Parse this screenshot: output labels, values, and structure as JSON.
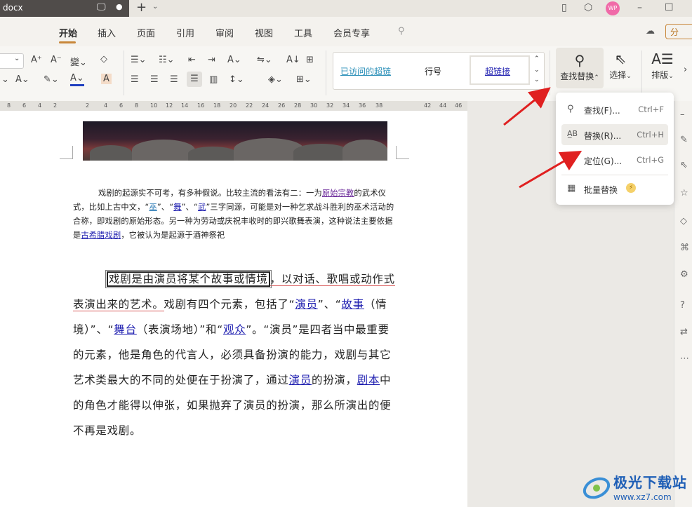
{
  "titlebar": {
    "doc_name": "docx",
    "modified_dot": "●",
    "new_tab": "+",
    "avatar": "WP"
  },
  "menu": {
    "items": [
      "开始",
      "插入",
      "页面",
      "引用",
      "审阅",
      "视图",
      "工具",
      "会员专享"
    ],
    "share": "分"
  },
  "ribbon": {
    "styles": [
      "已访问的超链",
      "行号",
      "超链接"
    ],
    "find_replace": "查找替换",
    "select": "选择",
    "layout": "排版"
  },
  "ruler": {
    "ticks": [
      "8",
      "6",
      "4",
      "2",
      "2",
      "4",
      "6",
      "8",
      "10",
      "12",
      "14",
      "16",
      "18",
      "20",
      "22",
      "24",
      "26",
      "28",
      "30",
      "32",
      "34",
      "36",
      "38",
      "42",
      "44",
      "46",
      "48"
    ]
  },
  "dropdown": {
    "items": [
      {
        "label": "查找(F)...",
        "shortcut": "Ctrl+F"
      },
      {
        "label": "替换(R)...",
        "shortcut": "Ctrl+H"
      },
      {
        "label": "定位(G)...",
        "shortcut": "Ctrl+G"
      },
      {
        "label": "批量替换",
        "shortcut": ""
      }
    ]
  },
  "doc": {
    "p1": {
      "t1": "戏剧的起源实不可考，有多种假说。比较主流的看法有二：一为",
      "l1": "原始宗教",
      "t2": "的武术仪式，比如上古中文，“",
      "l2": "巫",
      "t3": "”、“",
      "l3": "舞",
      "t4": "”、“",
      "l4": "武",
      "t5": "”三字同源，可能是对一种乞求战斗胜利的巫术活动的合称，即戏剧的原始形态。另一种为劳动或庆祝丰收时的即兴歌舞表演，这种说法主要依据是",
      "l5": "古希腊戏剧",
      "t6": "，它被认为是起源于酒神祭祀"
    },
    "p2": {
      "sel": "戏剧是由演员将某个故事或情境",
      "t1": "，以对话、歌唱或动作式",
      "t2": "表演出来的艺术。",
      "t3": "戏剧有四个元素，包括了“",
      "l1": "演员",
      "t4": "”、“",
      "l2": "故事",
      "t5": "（情境）”、“",
      "l3": "舞台",
      "t6": "（表演场地）”和“",
      "l4": "观众",
      "t7": "”。“演员”是四者当中最重要的元素，他是角色的代言人，必须具备扮演的能力，戏剧与其它艺术类最大的不同的处便在于扮演了，通过",
      "l5": "演员",
      "t8": "的扮演，",
      "l6": "剧本",
      "t9": "中的角色才能得以伸张，如果抛弃了演员的扮演，那么所演出的便不再是戏剧。"
    }
  },
  "watermark": {
    "title": "极光下载站",
    "url": "www.xz7.com"
  }
}
